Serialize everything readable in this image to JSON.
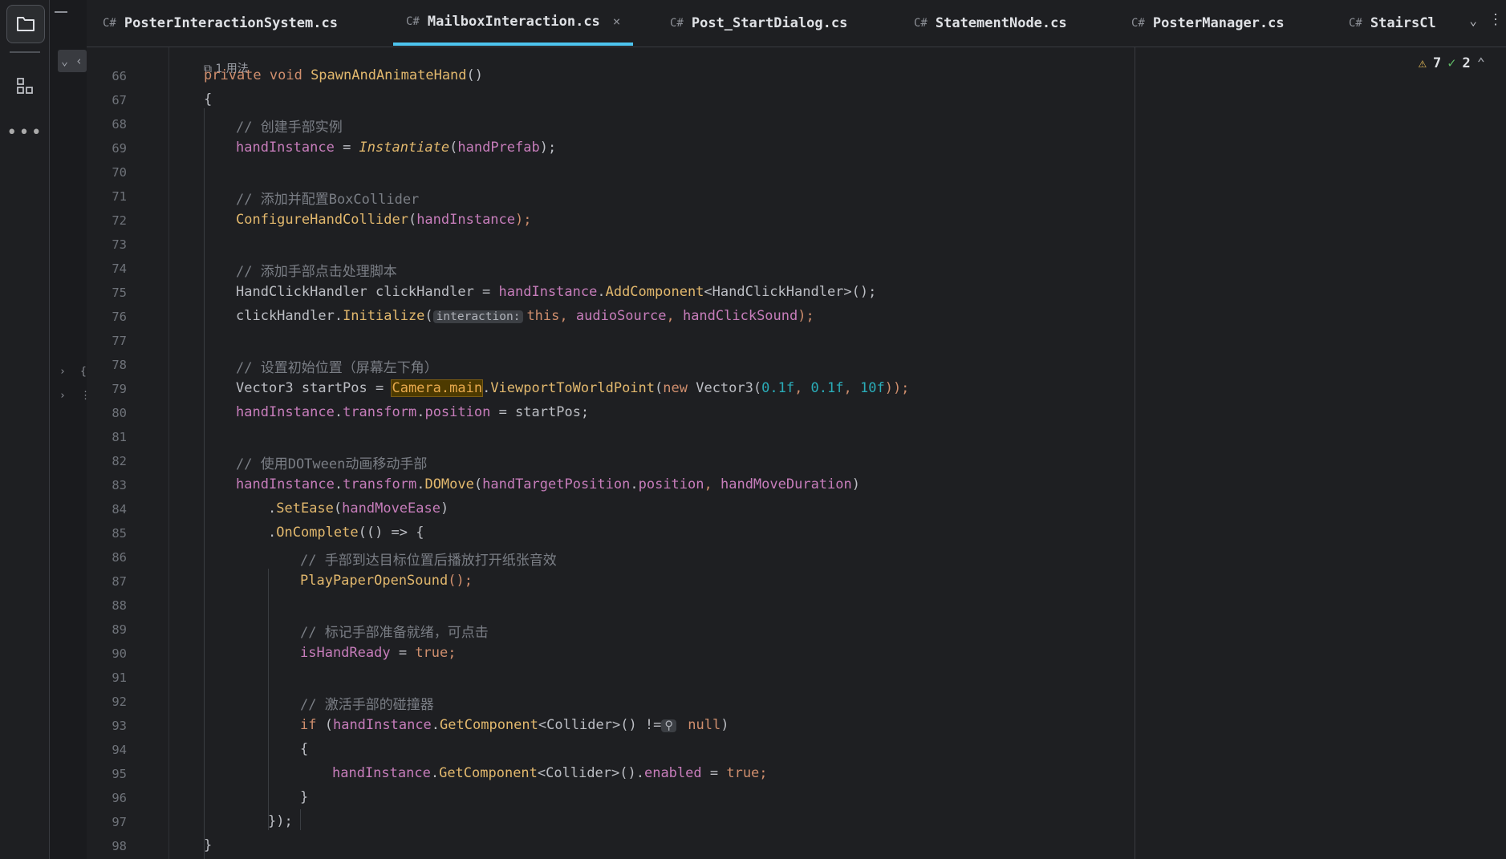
{
  "tabs": [
    {
      "lang": "C#",
      "name": "PosterInteractionSystem.cs",
      "active": false
    },
    {
      "lang": "C#",
      "name": "MailboxInteraction.cs",
      "active": true,
      "close": "×"
    },
    {
      "lang": "C#",
      "name": "Post_StartDialog.cs",
      "active": false
    },
    {
      "lang": "C#",
      "name": "StatementNode.cs",
      "active": false
    },
    {
      "lang": "C#",
      "name": "PosterManager.cs",
      "active": false
    },
    {
      "lang": "C#",
      "name": "StairsCl",
      "active": false
    }
  ],
  "usage_hint": "1 用法",
  "inspections": {
    "warnings": "7",
    "ok": "2"
  },
  "param_hint": "interaction:",
  "null_hint": "⚲",
  "line_numbers": [
    "66",
    "67",
    "68",
    "69",
    "70",
    "71",
    "72",
    "73",
    "74",
    "75",
    "76",
    "77",
    "78",
    "79",
    "80",
    "81",
    "82",
    "83",
    "84",
    "85",
    "86",
    "87",
    "88",
    "89",
    "90",
    "91",
    "92",
    "93",
    "94",
    "95",
    "96",
    "97",
    "98"
  ],
  "code": {
    "l66_k": "private void ",
    "l66_fn": "SpawnAndAnimateHand",
    "l66_p": "()",
    "l67": "{",
    "l68": "// 创建手部实例",
    "l69_a": "handInstance",
    "l69_b": " = ",
    "l69_c": "Instantiate",
    "l69_d": "(",
    "l69_e": "handPrefab",
    "l69_f": ");",
    "l71": "// 添加并配置BoxCollider",
    "l72_a": "ConfigureHandCollider",
    "l72_b": "(",
    "l72_c": "handInstance",
    "l72_d": ");",
    "l74": "// 添加手部点击处理脚本",
    "l75_a": "HandClickHandler clickHandler = ",
    "l75_b": "handInstance",
    "l75_c": ".",
    "l75_d": "AddComponent",
    "l75_e": "<HandClickHandler>();",
    "l76_a": "clickHandler.",
    "l76_b": "Initialize",
    "l76_c": "(",
    "l76_e": "this",
    "l76_f": ", ",
    "l76_g": "audioSource",
    "l76_h": ", ",
    "l76_i": "handClickSound",
    "l76_j": ");",
    "l78": "// 设置初始位置（屏幕左下角）",
    "l79_a": "Vector3 startPos = ",
    "l79_b": "Camera.main",
    "l79_c": ".",
    "l79_d": "ViewportToWorldPoint",
    "l79_e": "(",
    "l79_f": "new ",
    "l79_g": "Vector3(",
    "l79_h": "0.1f",
    "l79_i": ", ",
    "l79_j": "0.1f",
    "l79_k": ", ",
    "l79_l": "10f",
    "l79_m": "));",
    "l80_a": "handInstance",
    "l80_b": ".",
    "l80_c": "transform",
    "l80_d": ".",
    "l80_e": "position",
    "l80_f": " = startPos;",
    "l82": "// 使用DOTween动画移动手部",
    "l83_a": "handInstance",
    "l83_b": ".",
    "l83_c": "transform",
    "l83_d": ".",
    "l83_e": "DOMove",
    "l83_f": "(",
    "l83_g": "handTargetPosition",
    "l83_h": ".",
    "l83_i": "position",
    "l83_j": ", ",
    "l83_k": "handMoveDuration",
    "l83_l": ")",
    "l84_a": ".",
    "l84_b": "SetEase",
    "l84_c": "(",
    "l84_d": "handMoveEase",
    "l84_e": ")",
    "l85_a": ".",
    "l85_b": "OnComplete",
    "l85_c": "(() => {",
    "l86": "// 手部到达目标位置后播放打开纸张音效",
    "l87_a": "PlayPaperOpenSound",
    "l87_b": "();",
    "l89": "// 标记手部准备就绪，可点击",
    "l90_a": "isHandReady",
    "l90_b": " = ",
    "l90_c": "true",
    "l90_d": ";",
    "l92": "// 激活手部的碰撞器",
    "l93_a": "if ",
    "l93_b": "(",
    "l93_c": "handInstance",
    "l93_d": ".",
    "l93_e": "GetComponent",
    "l93_f": "<Collider>() !=",
    "l93_h": " null",
    "l93_i": ")",
    "l94": "{",
    "l95_a": "handInstance",
    "l95_b": ".",
    "l95_c": "GetComponent",
    "l95_d": "<Collider>().",
    "l95_e": "enabled",
    "l95_f": " = ",
    "l95_g": "true",
    "l95_h": ";",
    "l96": "}",
    "l97": "});",
    "l98": "}"
  },
  "colors": {
    "accent": "#4dc4ef",
    "keyword": "#cf8e6d",
    "field": "#c77dbb",
    "method": "#56a8f5",
    "comment": "#7a7e85",
    "number": "#2aacb8",
    "background": "#1e1f22"
  }
}
